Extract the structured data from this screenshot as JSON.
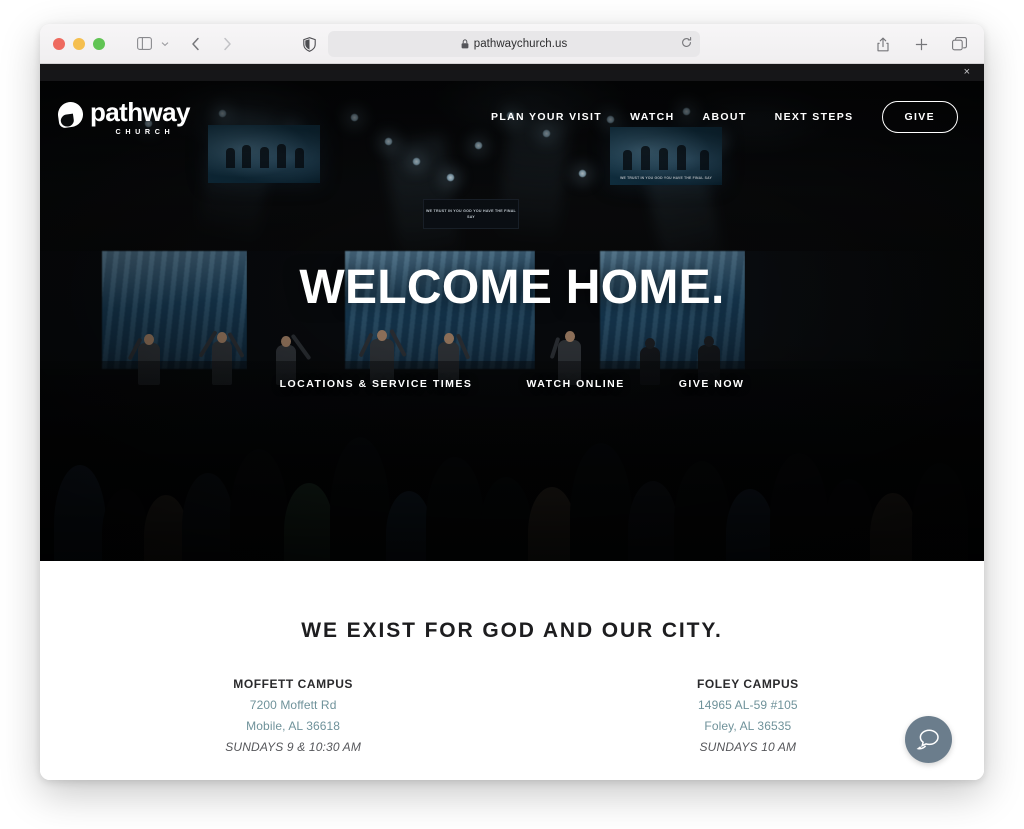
{
  "browser": {
    "url": "pathwaychurch.us",
    "lock_icon": "lock-icon",
    "reload_icon": "reload-icon",
    "sidebar_icon": "sidebar-toggle-icon",
    "sidebar_chevron_icon": "chevron-down-icon",
    "back_icon": "back-arrow-icon",
    "forward_icon": "forward-arrow-icon",
    "shield_icon": "privacy-shield-icon",
    "share_icon": "share-icon",
    "new_tab_icon": "plus-icon",
    "tabs_icon": "tab-overview-icon",
    "traffic_lights": [
      "close",
      "minimize",
      "zoom"
    ]
  },
  "page": {
    "close_banner_label": "×",
    "header": {
      "logo_word": "pathway",
      "logo_sub": "CHURCH",
      "nav": [
        {
          "label": "PLAN YOUR VISIT"
        },
        {
          "label": "WATCH"
        },
        {
          "label": "ABOUT"
        },
        {
          "label": "NEXT STEPS"
        }
      ],
      "give_button": "GIVE"
    },
    "hero": {
      "title": "WELCOME HOME.",
      "ctas": [
        {
          "label": "LOCATIONS & SERVICE TIMES"
        },
        {
          "label": "WATCH ONLINE"
        },
        {
          "label": "GIVE NOW"
        }
      ],
      "screen_lyrics": "WE TRUST IN YOU GOD\nYOU HAVE THE FINAL SAY"
    },
    "section": {
      "title": "WE EXIST FOR GOD AND OUR CITY.",
      "campuses": [
        {
          "name": "MOFFETT CAMPUS",
          "address1": "7200 Moffett Rd",
          "address2": "Mobile, AL 36618",
          "times": "SUNDAYS 9 & 10:30 AM"
        },
        {
          "name": "FOLEY CAMPUS",
          "address1": "14965 AL-59 #105",
          "address2": "Foley, AL 36535",
          "times": "SUNDAYS 10 AM"
        }
      ]
    },
    "chat_widget": {
      "icon": "chat-bubbles-icon"
    },
    "colors": {
      "hero_background": "#07090b",
      "accent_text": "#6f929a",
      "heading": "#1d1d1f",
      "chat_fab": "#6b7d8c"
    }
  }
}
